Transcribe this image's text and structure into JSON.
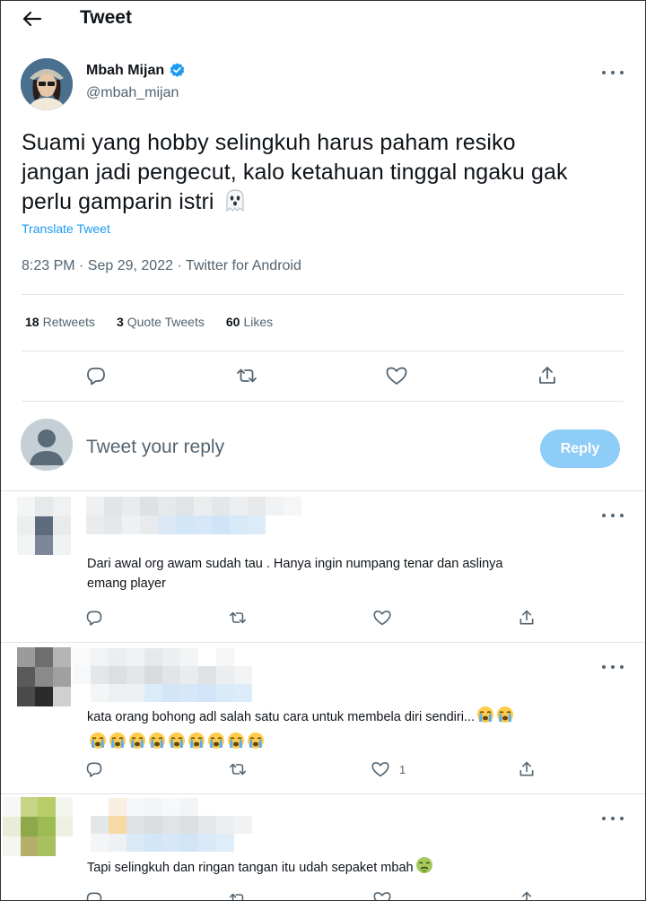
{
  "header": {
    "title": "Tweet"
  },
  "tweet": {
    "author_name": "Mbah Mijan",
    "author_handle": "@mbah_mijan",
    "text_line1": "Suami yang hobby selingkuh harus paham resiko",
    "text_line2": "jangan jadi pengecut, kalo ketahuan tinggal ngaku gak",
    "text_line3": "perlu gamparin istri",
    "translate_label": "Translate Tweet",
    "meta": "8:23 PM · Sep 29, 2022 · Twitter for Android",
    "stats": {
      "retweets_count": "18",
      "retweets_label": "Retweets",
      "quotes_count": "3",
      "quotes_label": "Quote Tweets",
      "likes_count": "60",
      "likes_label": "Likes"
    }
  },
  "compose": {
    "placeholder": "Tweet your reply",
    "button_label": "Reply"
  },
  "replies": [
    {
      "line1": "Dari awal org awam sudah tau . Hanya ingin numpang tenar dan aslinya",
      "line2": "emang player",
      "likes": ""
    },
    {
      "line1": "kata orang bohong adl salah satu cara untuk membela diri sendiri...",
      "line2": "",
      "likes": "1"
    },
    {
      "line1": "Tapi selingkuh dan ringan tangan itu udah sepaket mbah",
      "line2": "",
      "likes": ""
    }
  ],
  "colors": {
    "accent": "#1d9bf0",
    "reply_button": "#8ecdf7",
    "muted": "#536471"
  }
}
